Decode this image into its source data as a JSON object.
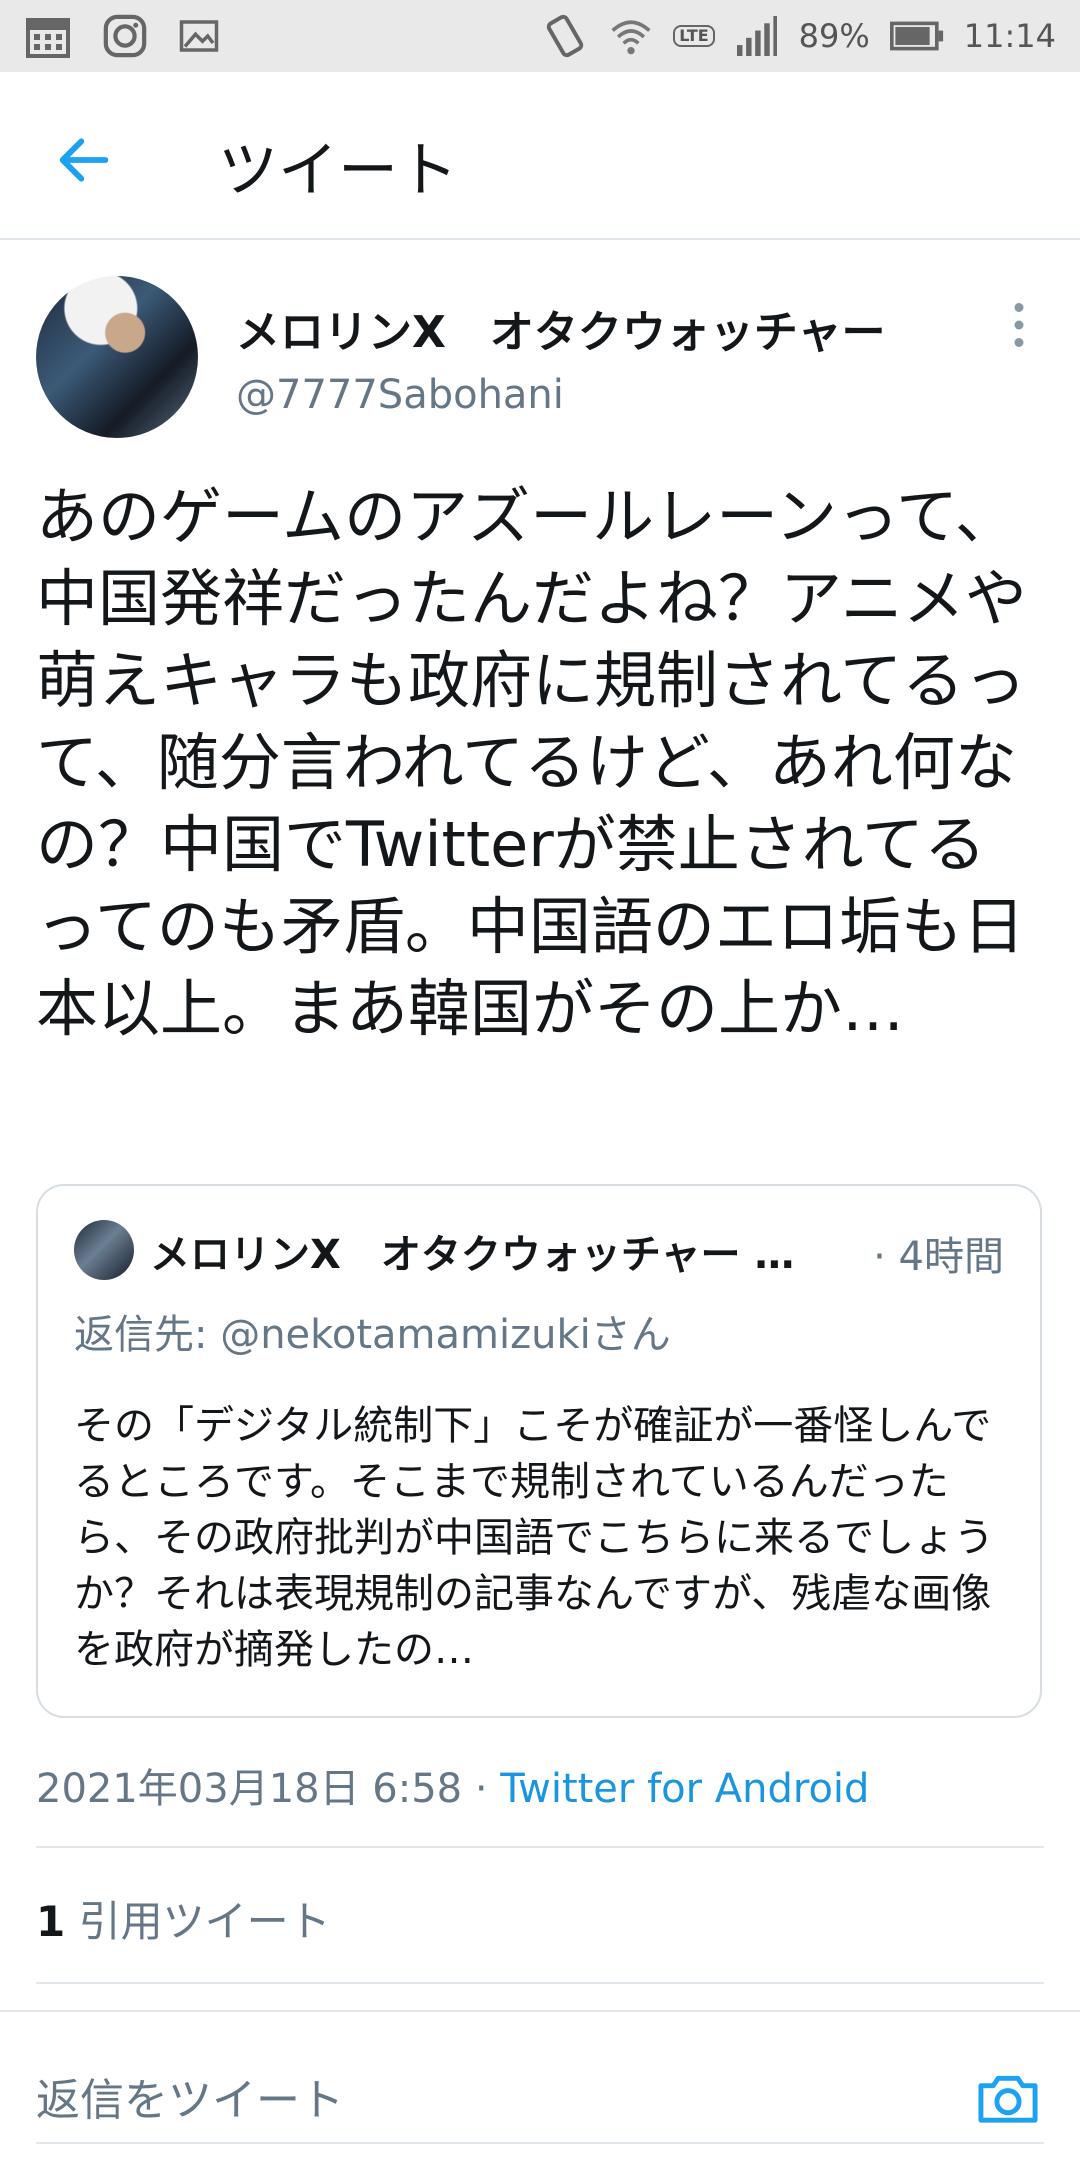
{
  "status_bar": {
    "battery": "89%",
    "time": "11:14",
    "network": "LTE",
    "icons": [
      "calendar-icon",
      "instagram-icon",
      "gallery-icon",
      "rotate-icon",
      "wifi-icon",
      "volte-icon",
      "signal-icon",
      "battery-icon"
    ]
  },
  "header": {
    "title": "ツイート",
    "back_icon": "arrow-left-icon"
  },
  "tweet": {
    "display_name": "メロリンX　オタクウォッチャー",
    "handle": "@7777Sabohani",
    "text": "あのゲームのアズールレーンって、中国発祥だったんだよね？アニメや萌えキャラも政府に規制されてるって、随分言われてるけど、あれ何なの？中国でTwitterが禁止されてるってのも矛盾。中国語のエロ垢も日本以上。まあ韓国がその上か…",
    "timestamp": "2021年03月18日 6:58",
    "separator": " · ",
    "client": "Twitter for Android",
    "quote_count": "1",
    "quote_label": "引用ツイート"
  },
  "quoted_tweet": {
    "display_name": "メロリンX　オタクウォッチャー …",
    "time": "· 4時間",
    "reply_to": "返信先: @nekotamamizukiさん",
    "text": "その「デジタル統制下」こそが確証が一番怪しんでるところです。そこまで規制されているんだったら、その政府批判が中国語でこちらに来るでしょうか？それは表現規制の記事なんですが、残虐な画像を政府が摘発したの…"
  },
  "reply_bar": {
    "placeholder": "返信をツイート",
    "camera_icon": "camera-icon"
  },
  "colors": {
    "accent": "#1b95e0",
    "secondary_text": "#657786",
    "divider": "#e1e8ed",
    "status_bar_bg": "#e9e9ea"
  }
}
